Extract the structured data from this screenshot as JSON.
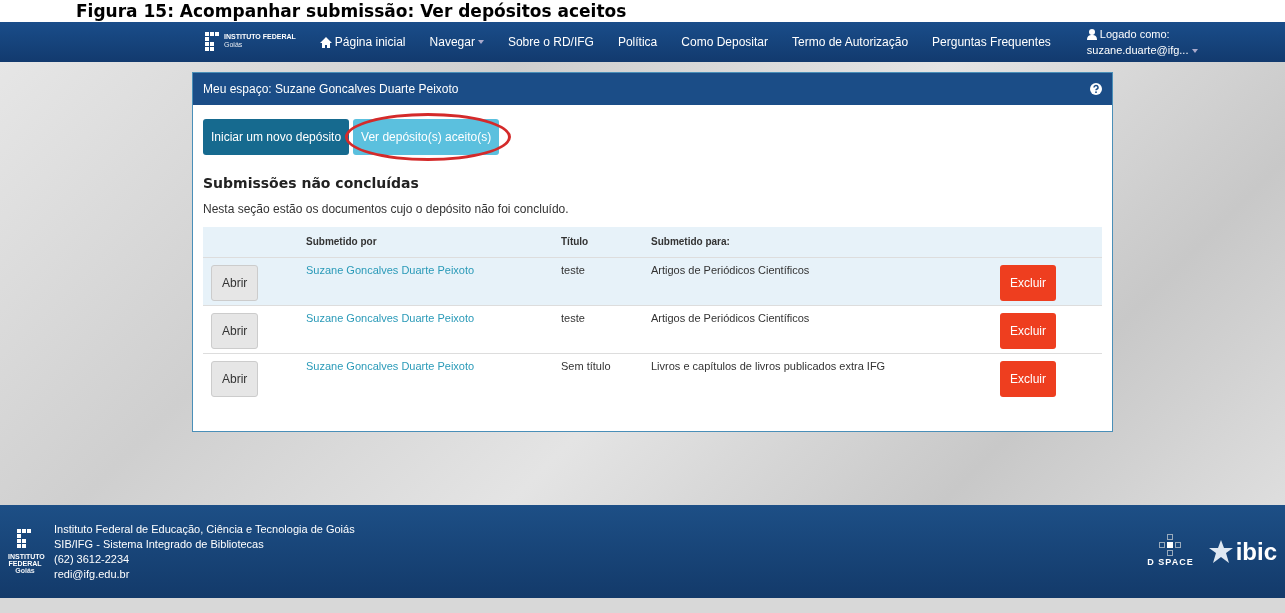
{
  "caption": "Figura 15: Acompanhar submissão: Ver depósitos aceitos",
  "navbar": {
    "logo": {
      "name": "INSTITUTO FEDERAL",
      "sub": "Goiás"
    },
    "items": [
      {
        "label": "Página inicial",
        "kind": "home",
        "dropdown": false
      },
      {
        "label": "Navegar",
        "kind": "link",
        "dropdown": true
      },
      {
        "label": "Sobre o RD/IFG",
        "kind": "link",
        "dropdown": false
      },
      {
        "label": "Política",
        "kind": "link",
        "dropdown": false
      },
      {
        "label": "Como Depositar",
        "kind": "link",
        "dropdown": false
      },
      {
        "label": "Termo de Autorização",
        "kind": "link",
        "dropdown": false
      },
      {
        "label": "Perguntas Frequentes",
        "kind": "link",
        "dropdown": false
      }
    ],
    "user": {
      "label": "Logado como:",
      "email": "suzane.duarte@ifg..."
    }
  },
  "panel": {
    "title": "Meu espaço: Suzane Goncalves Duarte Peixoto",
    "buttons": [
      {
        "label": "Iniciar um novo depósito",
        "kind": "primary",
        "circled": false
      },
      {
        "label": "Ver depósito(s) aceito(s)",
        "kind": "info",
        "circled": true
      }
    ],
    "section_title": "Submissões não concluídas",
    "description": "Nesta seção estão os documentos cujo o depósito não foi concluído.",
    "table": {
      "columns": [
        "Submetido por",
        "Título",
        "Submetido para:"
      ],
      "rows": [
        {
          "open": "Abrir",
          "submitter": "Suzane Goncalves Duarte Peixoto",
          "title": "teste",
          "collection": "Artigos de Periódicos Científicos",
          "delete": "Excluir"
        },
        {
          "open": "Abrir",
          "submitter": "Suzane Goncalves Duarte Peixoto",
          "title": "teste",
          "collection": "Artigos de Periódicos Científicos",
          "delete": "Excluir"
        },
        {
          "open": "Abrir",
          "submitter": "Suzane Goncalves Duarte Peixoto",
          "title": "Sem título",
          "collection": "Livros e capítulos de livros publicados extra IFG",
          "delete": "Excluir"
        }
      ]
    }
  },
  "footer": {
    "logo": {
      "name": "INSTITUTO FEDERAL",
      "sub": "Goiás"
    },
    "lines": [
      "Instituto Federal de Educação, Ciência e Tecnologia de Goiás",
      "SIB/IFG - Sistema Integrado de Bibliotecas",
      "(62) 3612-2234",
      "redi@ifg.edu.br"
    ],
    "partners": [
      "D SPACE",
      "ibic"
    ]
  }
}
